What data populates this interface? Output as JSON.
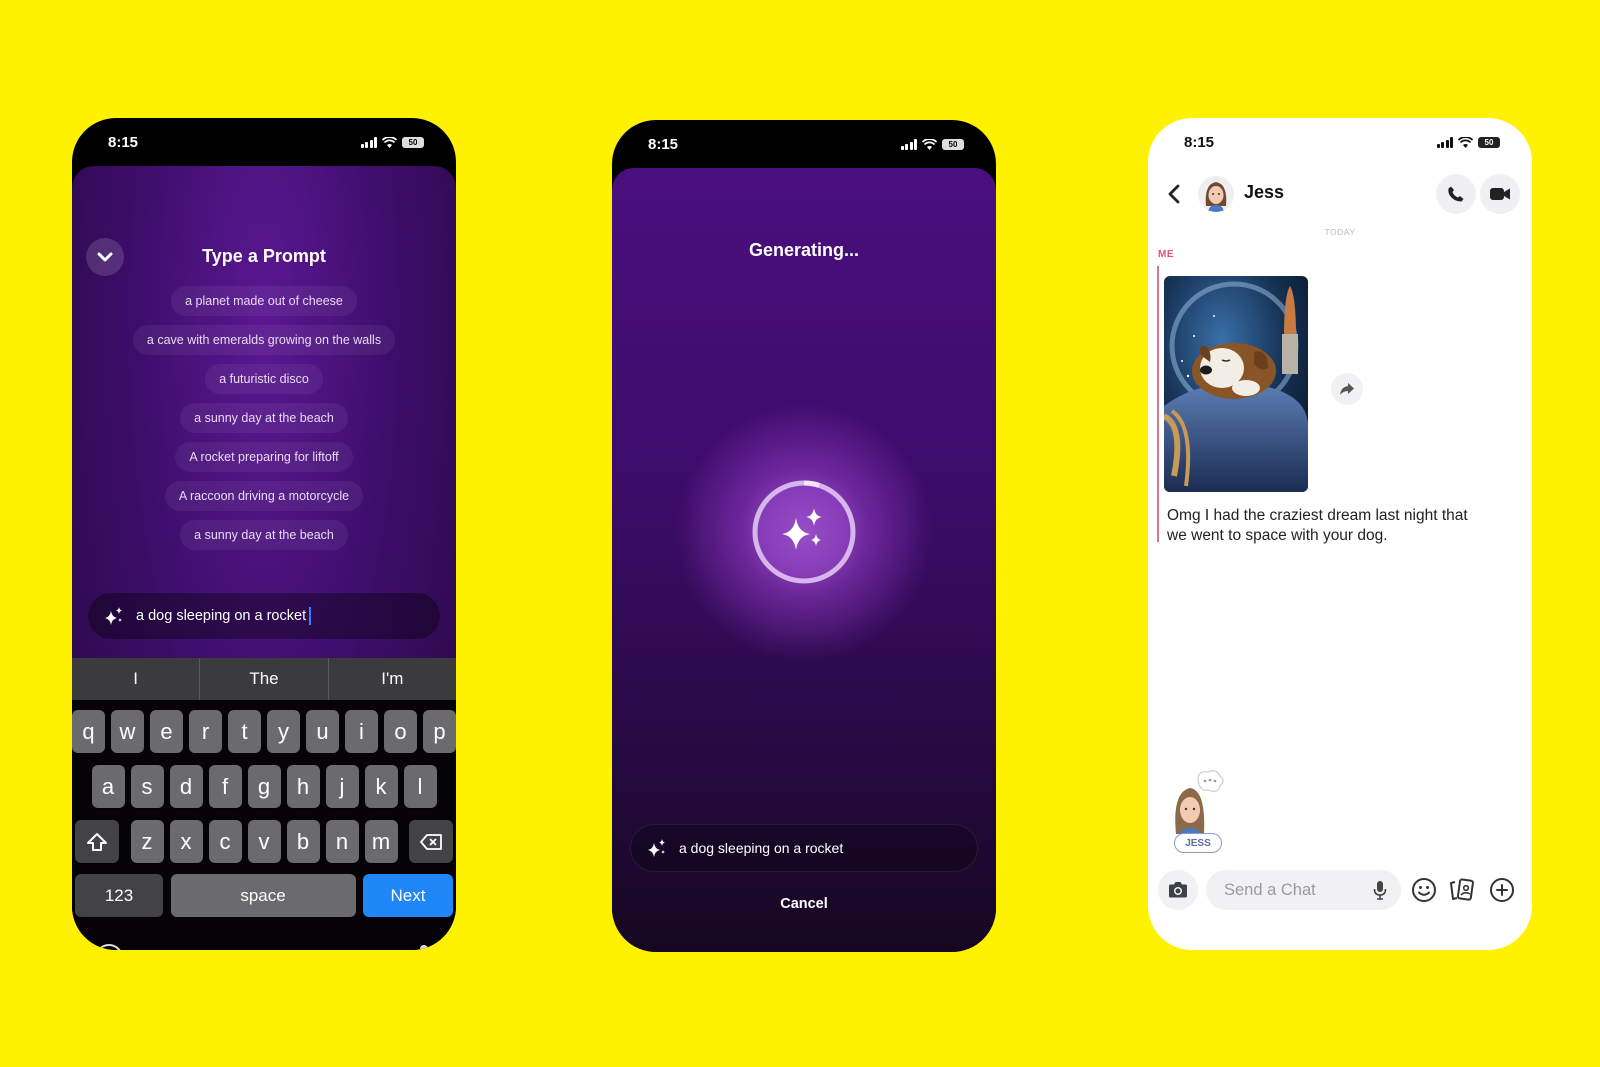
{
  "colors": {
    "background": "#FFF200",
    "purple_accent": "#4a0f7e",
    "keyboard_next": "#1f86f5",
    "me_label": "#e6526e"
  },
  "status_bar": {
    "time": "8:15",
    "battery": "50"
  },
  "prompt_screen": {
    "title": "Type a Prompt",
    "collapse_icon": "chevron-down-icon",
    "suggestions": [
      "a planet made out of cheese",
      "a cave with emeralds growing on the walls",
      "a futuristic disco",
      "a sunny day at the beach",
      "A rocket preparing for liftoff",
      "A raccoon driving a motorcycle",
      "a sunny day at the beach"
    ],
    "input": {
      "value": "a dog sleeping on a rocket",
      "icon": "sparkle-icon"
    },
    "keyboard": {
      "predictions": [
        "I",
        "The",
        "I'm"
      ],
      "row1": [
        "q",
        "w",
        "e",
        "r",
        "t",
        "y",
        "u",
        "i",
        "o",
        "p"
      ],
      "row2": [
        "a",
        "s",
        "d",
        "f",
        "g",
        "h",
        "j",
        "k",
        "l"
      ],
      "row3": [
        "z",
        "x",
        "c",
        "v",
        "b",
        "n",
        "m"
      ],
      "numbers_label": "123",
      "space_label": "space",
      "return_label": "Next"
    }
  },
  "generating_screen": {
    "title": "Generating...",
    "progress": 0.05,
    "prompt": "a dog sleeping on a rocket",
    "cancel_label": "Cancel"
  },
  "chat_screen": {
    "contact_name": "Jess",
    "date_divider": "TODAY",
    "sender_label": "ME",
    "message_text": "Omg I had the craziest dream last night that we went to space with your dog.",
    "image_alt": "AI-generated dog sleeping on a rocket in space",
    "typing_badge": "JESS",
    "input_placeholder": "Send a Chat"
  }
}
